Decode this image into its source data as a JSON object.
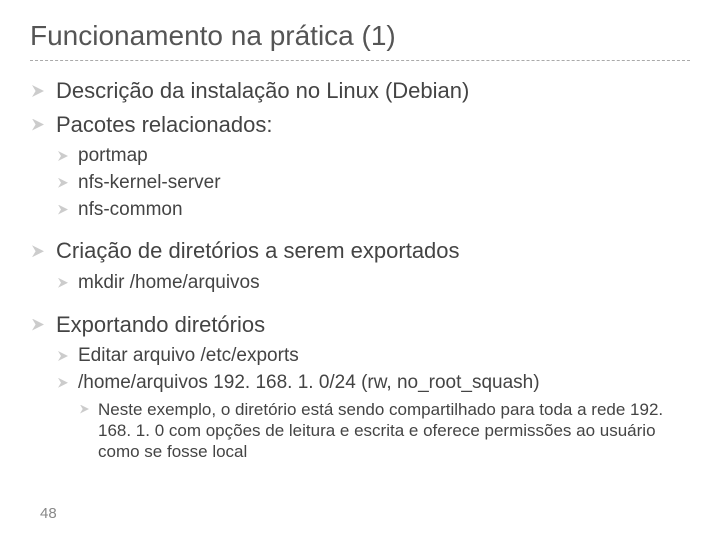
{
  "title": "Funcionamento na prática (1)",
  "items": [
    {
      "text": "Descrição da instalação no Linux (Debian)"
    },
    {
      "text": "Pacotes relacionados:",
      "children": [
        {
          "text": "portmap"
        },
        {
          "text": "nfs-kernel-server"
        },
        {
          "text": "nfs-common"
        }
      ]
    },
    {
      "text": "Criação de diretórios a serem exportados",
      "children": [
        {
          "text": "mkdir /home/arquivos"
        }
      ]
    },
    {
      "text": "Exportando diretórios",
      "children": [
        {
          "text": "Editar arquivo /etc/exports"
        },
        {
          "text": "/home/arquivos 192. 168. 1. 0/24 (rw, no_root_squash)",
          "children": [
            {
              "text": "Neste exemplo, o diretório está sendo compartilhado para toda a rede 192. 168. 1. 0 com opções de leitura e escrita e oferece permissões ao usuário como se fosse local"
            }
          ]
        }
      ]
    }
  ],
  "page": "48"
}
